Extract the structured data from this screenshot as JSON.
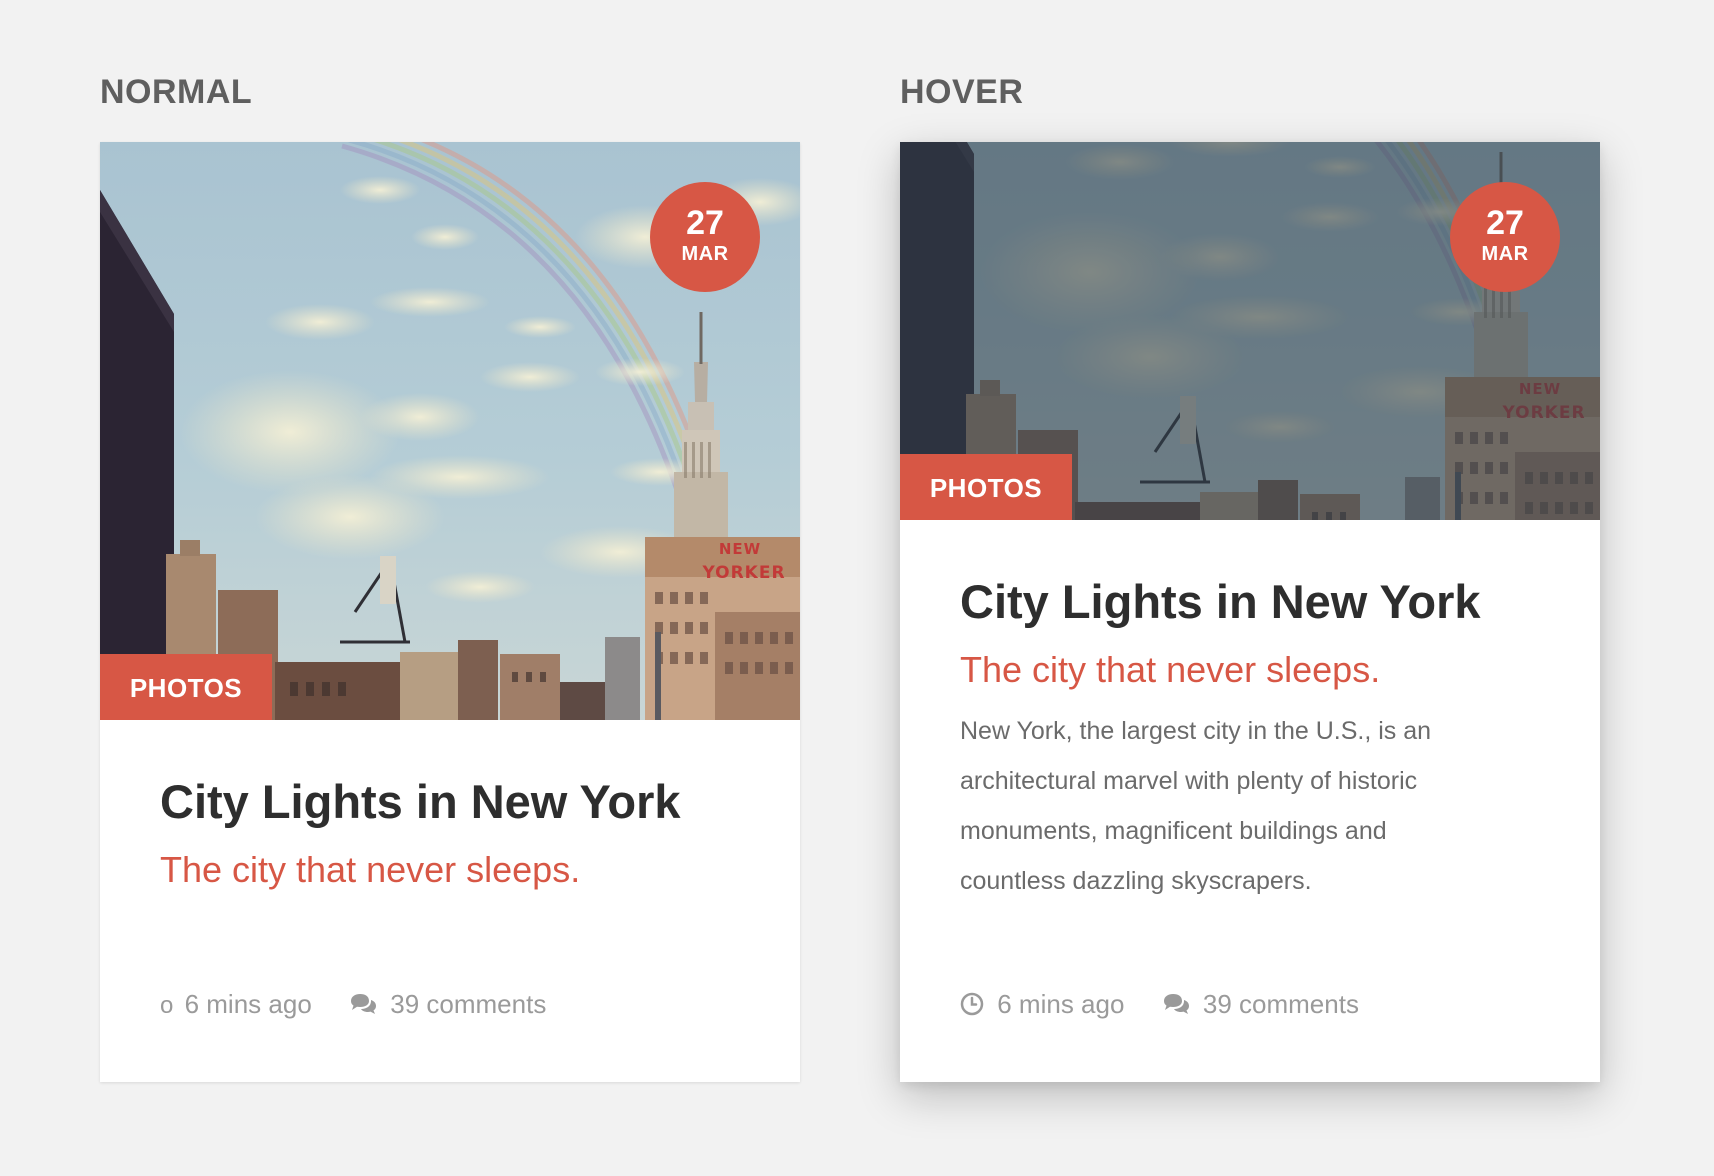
{
  "labels": {
    "normal": "NORMAL",
    "hover": "HOVER"
  },
  "cards": {
    "normal": {
      "date_day": "27",
      "date_month": "MAR",
      "category": "PHOTOS",
      "title": "City Lights in New York",
      "subtitle": "The city that never sleeps.",
      "time_ago": "6 mins ago",
      "time_icon_glyph": "o",
      "comments": "39 comments",
      "icons": {
        "time": "clock-icon (rendered as a small 'o' glyph)",
        "comments": "speech-bubbles-icon"
      }
    },
    "hover": {
      "date_day": "27",
      "date_month": "MAR",
      "category": "PHOTOS",
      "title": "City Lights in New York",
      "subtitle": "The city that never sleeps.",
      "body_lines": [
        "New York, the largest city in the U.S., is an",
        "architectural marvel with plenty of historic",
        "monuments, magnificent buildings and",
        "countless dazzling skyscrapers."
      ],
      "time_ago": "6 mins ago",
      "comments": "39 comments",
      "icons": {
        "time": "clock-icon",
        "comments": "speech-bubbles-icon"
      }
    }
  },
  "image_text": {
    "sign": "NEW YORKER"
  },
  "colors": {
    "accent": "#d75745",
    "background": "#f2f2f2",
    "card": "#ffffff",
    "title": "#2e2e2e",
    "body": "#6b6b6b",
    "meta": "#9a9a9a",
    "state_label": "#5f5f5f",
    "hover_overlay": "rgba(47, 62, 74, 0.58)"
  }
}
